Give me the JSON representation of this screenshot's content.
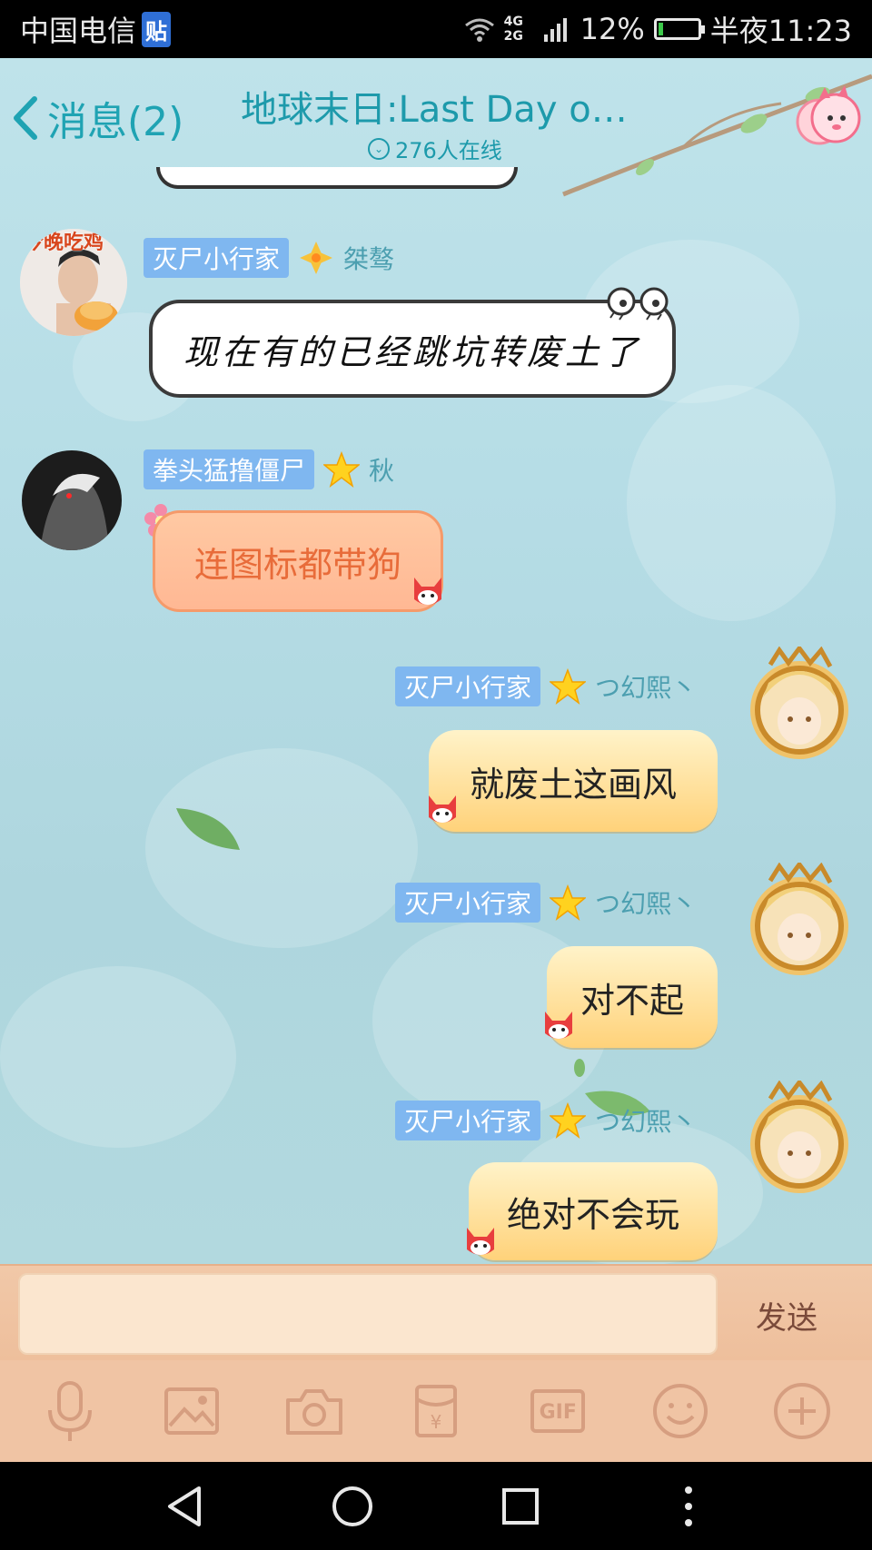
{
  "status_bar": {
    "carrier": "中国电信",
    "carrier_badge": "贴",
    "network": "4G 2G",
    "battery_percent": "12%",
    "time": "半夜11:23",
    "battery_level": 0.12
  },
  "header": {
    "back_label": "消息(2)",
    "title": "地球末日:Last Day on...",
    "online_count": "276人在线"
  },
  "messages": [
    {
      "side": "left",
      "title_tag": "灭尸小行家",
      "nickname": "桀骜",
      "text": "现在有的已经跳坑转废土了",
      "avatar_caption": "今晚吃鸡",
      "bubble_style": "handwritten"
    },
    {
      "side": "left",
      "title_tag": "拳头猛撸僵尸",
      "nickname": "秋",
      "text": "连图标都带狗",
      "bubble_style": "peach"
    },
    {
      "side": "right",
      "title_tag": "灭尸小行家",
      "nickname": "つ幻熙丶",
      "text": "就废土这画风",
      "bubble_style": "yellow"
    },
    {
      "side": "right",
      "title_tag": "灭尸小行家",
      "nickname": "つ幻熙丶",
      "text": "对不起",
      "bubble_style": "yellow"
    },
    {
      "side": "right",
      "title_tag": "灭尸小行家",
      "nickname": "つ幻熙丶",
      "text": "绝对不会玩",
      "bubble_style": "yellow"
    }
  ],
  "input": {
    "placeholder": "",
    "send_label": "发送"
  },
  "toolbar": {
    "items": [
      "mic-icon",
      "image-icon",
      "camera-icon",
      "red-packet-icon",
      "gif-icon",
      "emoji-icon",
      "plus-icon"
    ],
    "gif_label": "GIF"
  },
  "colors": {
    "accent": "#1d9aab",
    "tag_bg": "#7fb7f0",
    "input_bar": "#f0c4a4"
  }
}
